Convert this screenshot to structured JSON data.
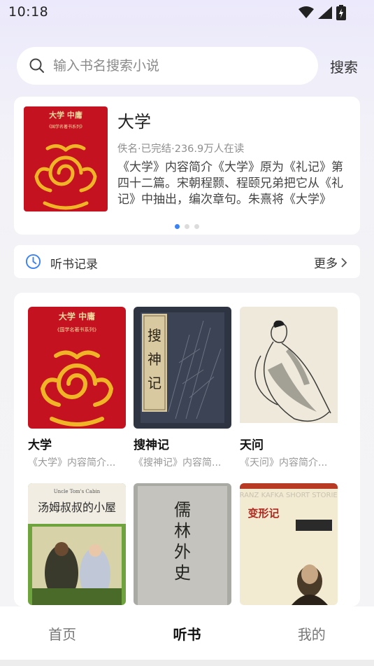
{
  "status_bar": {
    "time": "10:18"
  },
  "search": {
    "placeholder": "输入书名搜索小说",
    "button_label": "搜索"
  },
  "featured": {
    "title": "大学",
    "meta": "佚名·已完结·236.9万人在读",
    "description": "《大学》内容简介《大学》原为《礼记》第四十二篇。宋朝程颢、程颐兄弟把它从《礼记》中抽出，编次章句。朱熹将《大学》",
    "cover": {
      "top_text": "大学 中庸",
      "sub_text": "《国学名著书系列》"
    },
    "carousel_active_index": 0
  },
  "history": {
    "label": "听书记录",
    "more_label": "更多"
  },
  "books": [
    {
      "title": "大学",
      "desc": "《大学》内容简介...",
      "cover_top_text": "大学 中庸",
      "cover_sub_text": "《国学名著书系列》"
    },
    {
      "title": "搜神记",
      "desc": "《搜神记》内容简...",
      "cover_text": "搜神记"
    },
    {
      "title": "天问",
      "desc": "《天问》内容简介..."
    },
    {
      "title": "",
      "desc": "",
      "cover_en_text": "Uncle Tom's Cabin",
      "cover_text": "汤姆叔叔的小屋"
    },
    {
      "title": "",
      "desc": "",
      "cover_text": "儒林外史"
    },
    {
      "title": "",
      "desc": "",
      "cover_en_text": "FRANZ KAFKA SHORT STORIES",
      "cover_text": "变形记"
    }
  ],
  "nav": {
    "home": "首页",
    "listen": "听书",
    "mine": "我的",
    "active": "听书"
  },
  "colors": {
    "accent": "#3b82f6",
    "cover_red": "#c41220",
    "cover_gold": "#f0b526"
  }
}
